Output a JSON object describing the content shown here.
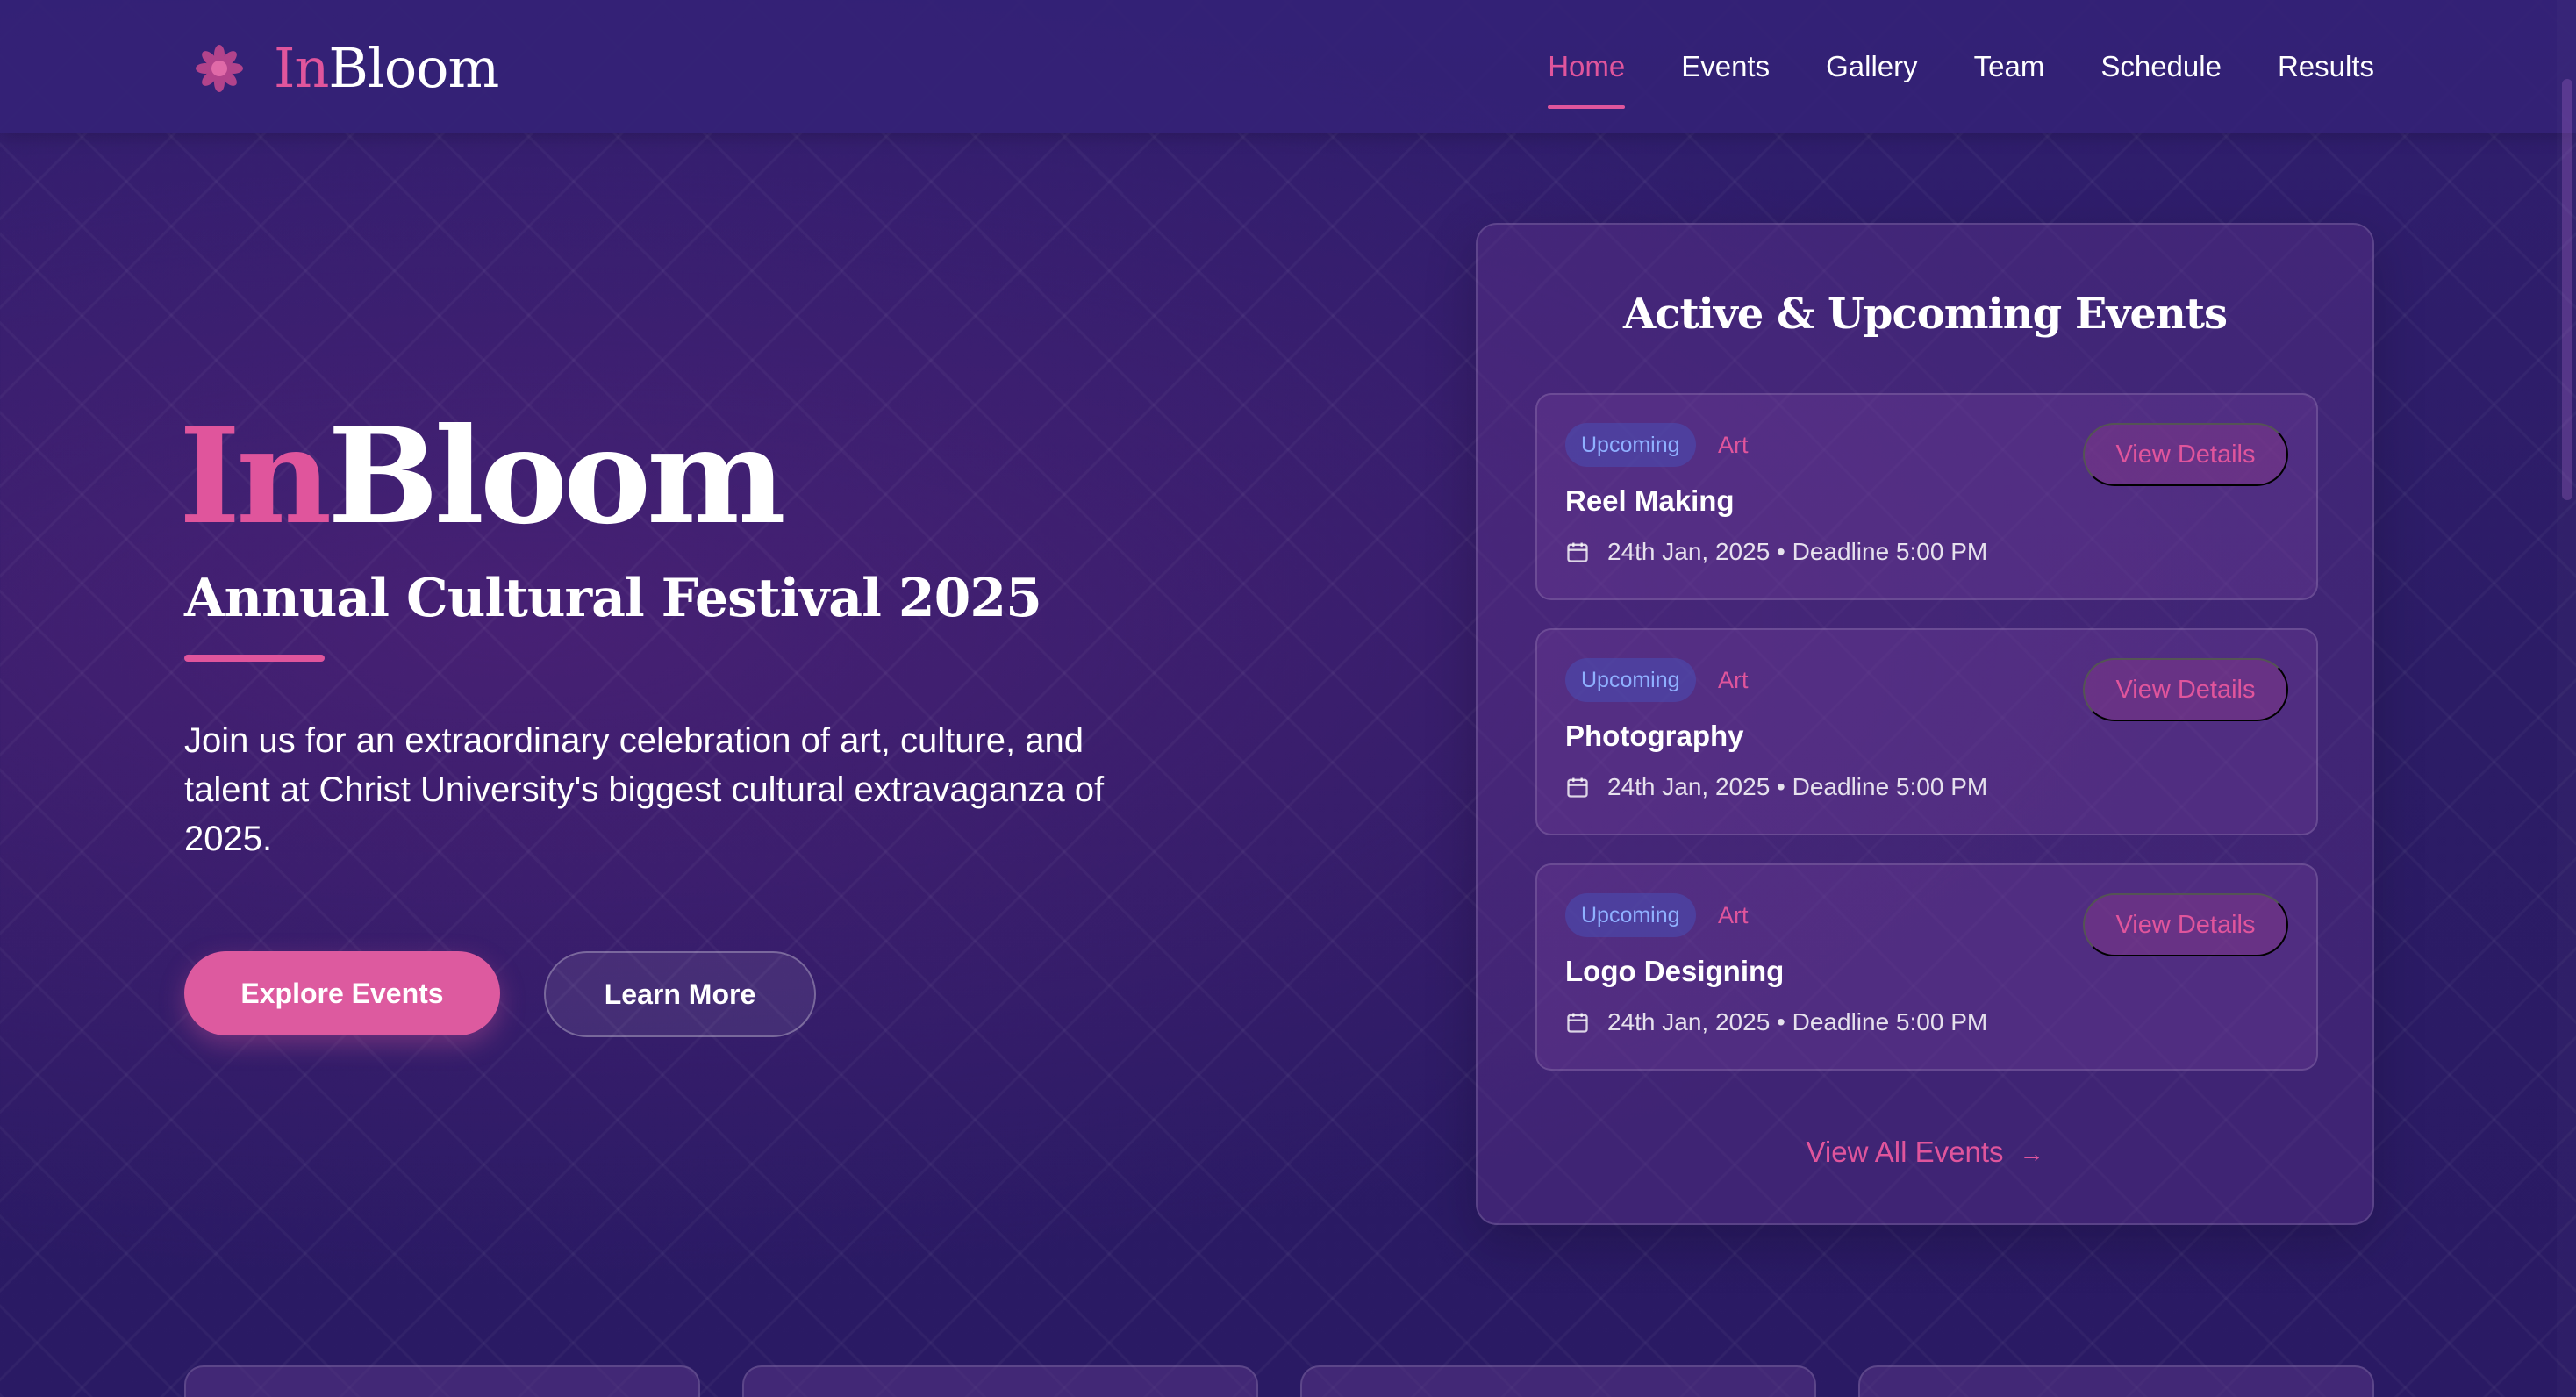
{
  "brand": {
    "name_accent": "In",
    "name_rest": "Bloom",
    "icon": "flower-icon"
  },
  "nav": {
    "items": [
      {
        "label": "Home",
        "active": true
      },
      {
        "label": "Events",
        "active": false
      },
      {
        "label": "Gallery",
        "active": false
      },
      {
        "label": "Team",
        "active": false
      },
      {
        "label": "Schedule",
        "active": false
      },
      {
        "label": "Results",
        "active": false
      }
    ]
  },
  "hero": {
    "title_accent": "In",
    "title_rest": "Bloom",
    "subtitle": "Annual Cultural Festival 2025",
    "description": "Join us for an extraordinary celebration of art, culture, and talent at Christ University's biggest cultural extravaganza of 2025.",
    "primary_button": "Explore Events",
    "secondary_button": "Learn More"
  },
  "events_panel": {
    "title": "Active & Upcoming Events",
    "events": [
      {
        "status": "Upcoming",
        "category": "Art",
        "name": "Reel Making",
        "date": "24th Jan, 2025 • Deadline 5:00 PM",
        "action": "View Details"
      },
      {
        "status": "Upcoming",
        "category": "Art",
        "name": "Photography",
        "date": "24th Jan, 2025 • Deadline 5:00 PM",
        "action": "View Details"
      },
      {
        "status": "Upcoming",
        "category": "Art",
        "name": "Logo Designing",
        "date": "24th Jan, 2025 • Deadline 5:00 PM",
        "action": "View Details"
      }
    ],
    "view_all": "View All Events"
  },
  "colors": {
    "accent": "#e0559c",
    "badge_text": "#8fb0ff",
    "background": "#2c1c66"
  }
}
